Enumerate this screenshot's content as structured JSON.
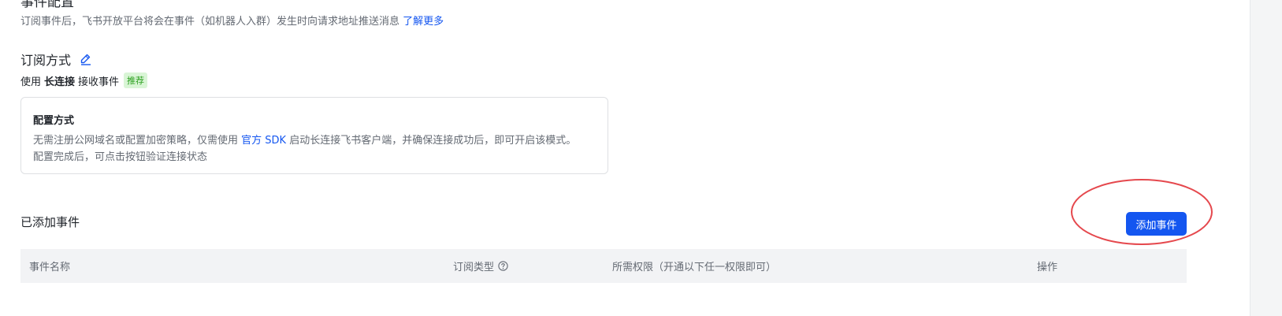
{
  "section": {
    "title": "事件配置"
  },
  "description": {
    "text": "订阅事件后，飞书开放平台将会在事件（如机器人入群）发生时向请求地址推送消息",
    "link": "了解更多"
  },
  "subscription": {
    "title": "订阅方式",
    "use_prefix": "使用",
    "method": "长连接",
    "use_suffix": "接收事件",
    "tag": "推荐"
  },
  "config_box": {
    "title": "配置方式",
    "line1_before": "无需注册公网域名或配置加密策略，仅需使用",
    "line1_link": "官方 SDK",
    "line1_after": "启动长连接飞书客户端，并确保连接成功后，即可开启该模式。",
    "line2": "配置完成后，可点击按钮验证连接状态"
  },
  "events": {
    "title": "已添加事件",
    "add_button": "添加事件",
    "columns": [
      "事件名称",
      "订阅类型",
      "所需权限（开通以下任一权限即可）",
      "操作"
    ]
  },
  "colors": {
    "accent": "#1456f0",
    "annotation": "#e5484d",
    "tag_green": "#2ea121"
  },
  "icons": {
    "edit": "pencil-edit-icon",
    "help": "question-circle-icon"
  }
}
